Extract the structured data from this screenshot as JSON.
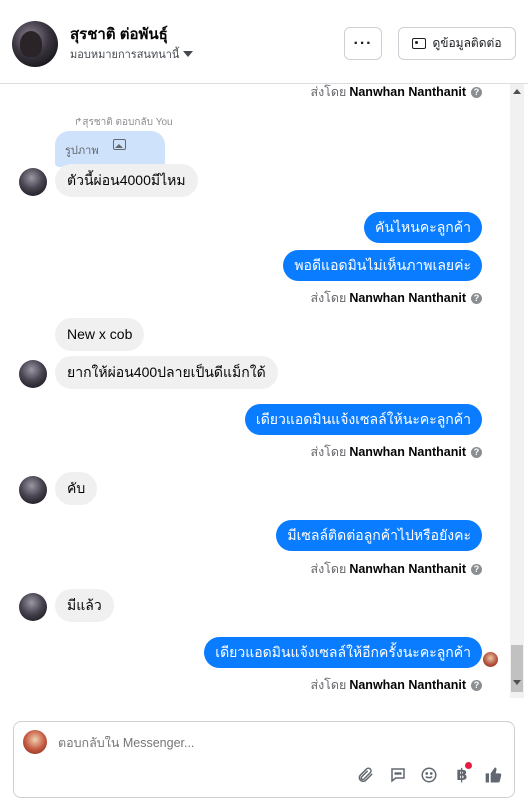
{
  "header": {
    "name": "สุรชาติ ต่อพันธุ์",
    "assignee": "มอบหมายการสนทนานี้",
    "more_label": "···",
    "contact_label": "ดูข้อมูลติดต่อ"
  },
  "sent_by": {
    "prefix": "ส่งโดย",
    "agent": "Nanwhan Nanthanit",
    "info_icon": "?"
  },
  "messages": [
    {
      "direction": "in",
      "reply_note": "สุรชาติ ตอบกลับ You",
      "quote_label": "รูปภาพ",
      "text": "ตัวนี้ผ่อน4000มีไหม"
    },
    {
      "direction": "out",
      "text": "คันไหนคะลูกค้า"
    },
    {
      "direction": "out",
      "text": "พอดีแอดมินไม่เห็นภาพเลยค่ะ"
    },
    {
      "direction": "in",
      "text": "New x cob"
    },
    {
      "direction": "in",
      "text": "ยากให้ผ่อน400ปลายเป็นดีแม็กใด้"
    },
    {
      "direction": "out",
      "text": "เดียวแอดมินแจ้งเซลล์ให้นะคะลูกค้า"
    },
    {
      "direction": "in",
      "text": "คับ"
    },
    {
      "direction": "out",
      "text": "มีเซลล์ติดต่อลูกค้าไปหรือยังคะ"
    },
    {
      "direction": "in",
      "text": "มีแล้ว"
    },
    {
      "direction": "out",
      "text": "เดียวแอดมินแจ้งเซลล์ให้อีกครั้งนะคะลูกค้า"
    }
  ],
  "composer": {
    "placeholder": "ตอบกลับใน Messenger...",
    "tools": [
      "attachment-icon",
      "saved-reply-icon",
      "emoji-icon",
      "baht-payment-icon",
      "like-icon"
    ]
  },
  "colors": {
    "outgoing_bubble": "#0a7cff",
    "incoming_bubble": "#f0f0f0",
    "quote_bubble": "#cfe2fc",
    "notification_dot": "#e41e3f"
  }
}
